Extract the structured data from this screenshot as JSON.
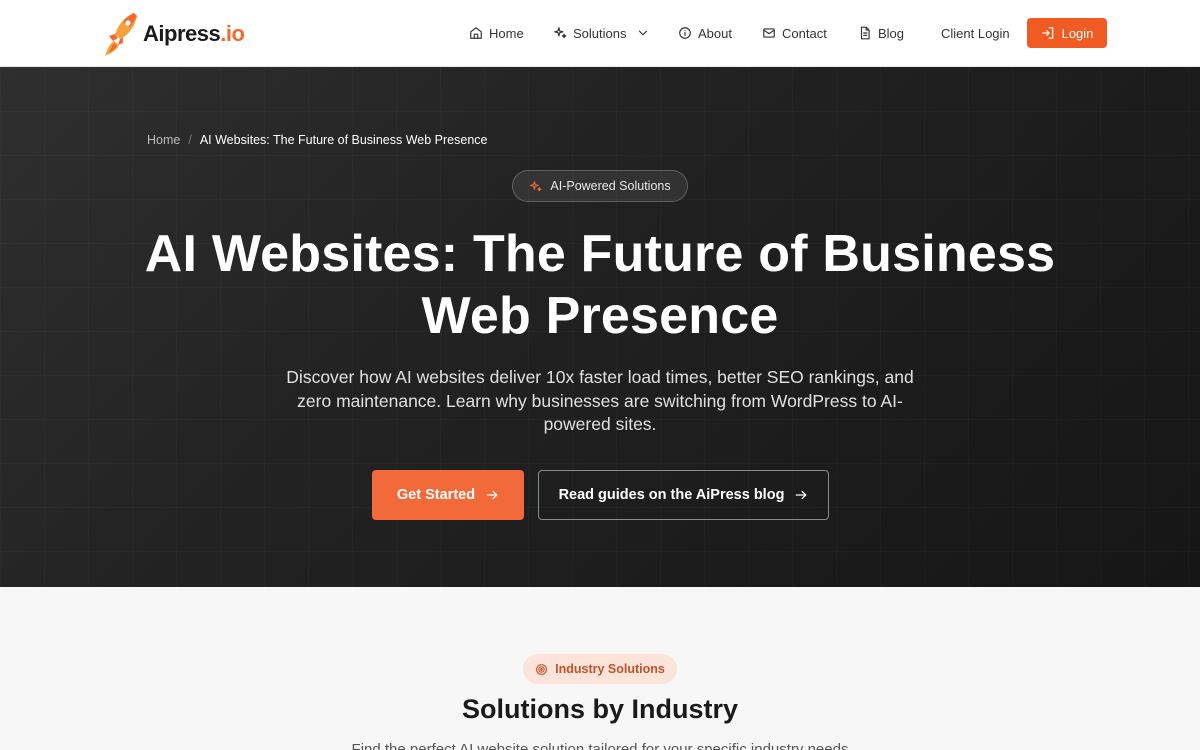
{
  "header": {
    "logo": {
      "name": "Aipress",
      "suffix": ".io"
    },
    "nav": {
      "home": "Home",
      "solutions": "Solutions",
      "about": "About",
      "contact": "Contact",
      "blog": "Blog",
      "client_login": "Client Login"
    },
    "login_label": "Login"
  },
  "hero": {
    "breadcrumb": {
      "home": "Home",
      "separator": "/",
      "current": "AI Websites: The Future of Business Web Presence"
    },
    "pill": "AI-Powered Solutions",
    "title_line1": "AI Websites: The Future of Business",
    "title_line2": "Web Presence",
    "subtitle": "Discover how AI websites deliver 10x faster load times, better SEO rankings, and zero maintenance. Learn why businesses are switching from WordPress to AI-powered sites.",
    "primary_cta": "Get Started",
    "secondary_cta": "Read guides on the AiPress blog"
  },
  "industry": {
    "pill": "Industry Solutions",
    "title": "Solutions by Industry",
    "subtitle": "Find the perfect AI website solution tailored for your specific industry needs"
  },
  "colors": {
    "accent": "#f25a24",
    "hero_bg": "#1f1f1f",
    "pill_bg": "#fde4da"
  },
  "icons": {
    "logo": "rocket-icon",
    "home": "house-icon",
    "solutions": "sparkles-icon",
    "about": "info-circle-icon",
    "contact": "mail-icon",
    "blog": "file-text-icon",
    "login": "login-arrow-icon",
    "cta": "arrow-right-icon",
    "industry": "target-icon"
  }
}
